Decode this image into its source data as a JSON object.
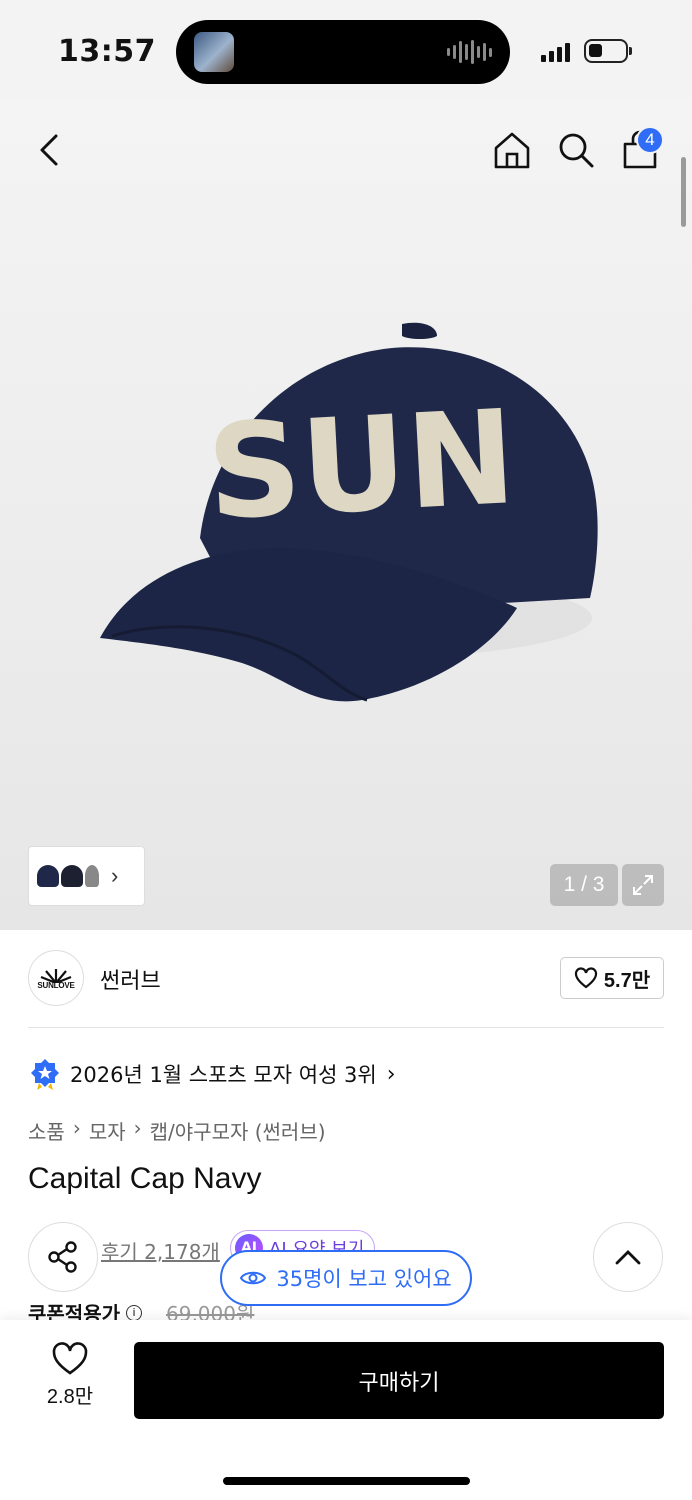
{
  "status_bar": {
    "time": "13:57"
  },
  "header": {
    "cart_count": "4"
  },
  "gallery": {
    "counter": "1 / 3"
  },
  "brand": {
    "name": "썬러브",
    "logo_text": "SUNLOVE",
    "likes": "5.7만"
  },
  "ranking": {
    "text": "2026년 1월 스포츠 모자 여성 3위"
  },
  "breadcrumb": [
    "소품",
    "모자",
    "캡/야구모자 (썬러브)"
  ],
  "product": {
    "title": "Capital Cap Navy",
    "review_link": "후기 2,178개",
    "ai_label": "AI 요약 보기",
    "ai_badge": "AI",
    "viewers": "35명이 보고 있어요",
    "coupon_label": "쿠폰적용가",
    "original_price": "69,000원",
    "cap_text": "SUN"
  },
  "bottom_bar": {
    "wish_count": "2.8만",
    "buy_label": "구매하기"
  },
  "colors": {
    "accent": "#2f6df6",
    "cap": "#1f2848",
    "letters": "#ddd7c3",
    "buy_button": "#000000"
  }
}
